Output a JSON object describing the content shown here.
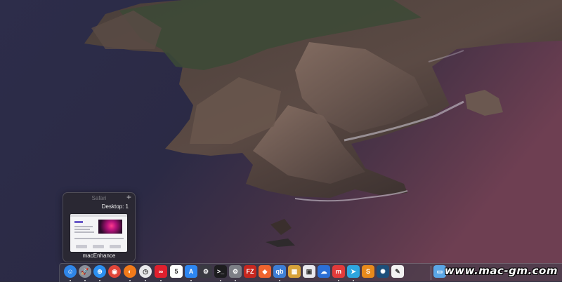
{
  "popup": {
    "app_name": "Safari",
    "new_window_symbol": "+",
    "desktop_label": "Desktop: 1",
    "window_label": "macEnhance"
  },
  "dock": {
    "items": [
      {
        "name": "finder-icon",
        "glyph": "☺",
        "color": "#2f86e8"
      },
      {
        "name": "launchpad-icon",
        "glyph": "🚀",
        "color": "#8a8f99"
      },
      {
        "name": "safari-icon",
        "glyph": "⊕",
        "color": "#2b8ff0"
      },
      {
        "name": "chrome-icon",
        "glyph": "◉",
        "color": "#e0463a"
      },
      {
        "name": "firefox-icon",
        "glyph": "◐",
        "color": "#f27a1a"
      },
      {
        "name": "clock-icon",
        "glyph": "◷",
        "color": "#e9e9ec"
      },
      {
        "name": "creative-cloud-icon",
        "glyph": "∞",
        "color": "#e0202e"
      },
      {
        "name": "notes-icon",
        "glyph": "≡",
        "color": "#f5d65a"
      },
      {
        "name": "calendar-icon",
        "glyph": "5",
        "color": "#ffffff"
      },
      {
        "name": "app-store-icon",
        "glyph": "A",
        "color": "#2d86f2"
      },
      {
        "name": "utility-icon",
        "glyph": "⚙",
        "color": "#3a3a42"
      },
      {
        "name": "terminal-icon",
        "glyph": ">_",
        "color": "#1d1d1f"
      },
      {
        "name": "system-preferences-icon",
        "glyph": "⚙",
        "color": "#7d7f86"
      },
      {
        "name": "filezilla-icon",
        "glyph": "FZ",
        "color": "#c7271f"
      },
      {
        "name": "swift-icon",
        "glyph": "◆",
        "color": "#f0642e"
      },
      {
        "name": "qbittorrent-icon",
        "glyph": "qb",
        "color": "#3d7fd6"
      },
      {
        "name": "photo-app-icon",
        "glyph": "▦",
        "color": "#d8a23a"
      },
      {
        "name": "preview-icon",
        "glyph": "▣",
        "color": "#e8e8ee"
      },
      {
        "name": "cloud-app-icon",
        "glyph": "☁",
        "color": "#2b6fd6"
      },
      {
        "name": "mindmap-icon",
        "glyph": "m",
        "color": "#e23b3b"
      },
      {
        "name": "telegram-icon",
        "glyph": "➤",
        "color": "#2ea6df"
      },
      {
        "name": "sublime-icon",
        "glyph": "S",
        "color": "#e88a1c"
      },
      {
        "name": "image-tool-icon",
        "glyph": "✺",
        "color": "#1d4f7a"
      },
      {
        "name": "textedit-icon",
        "glyph": "✎",
        "color": "#f2f2f2"
      },
      {
        "name": "downloads-folder-icon",
        "glyph": "▭",
        "color": "#5aa6e6"
      }
    ]
  },
  "watermark": "www.mac-gm.com"
}
